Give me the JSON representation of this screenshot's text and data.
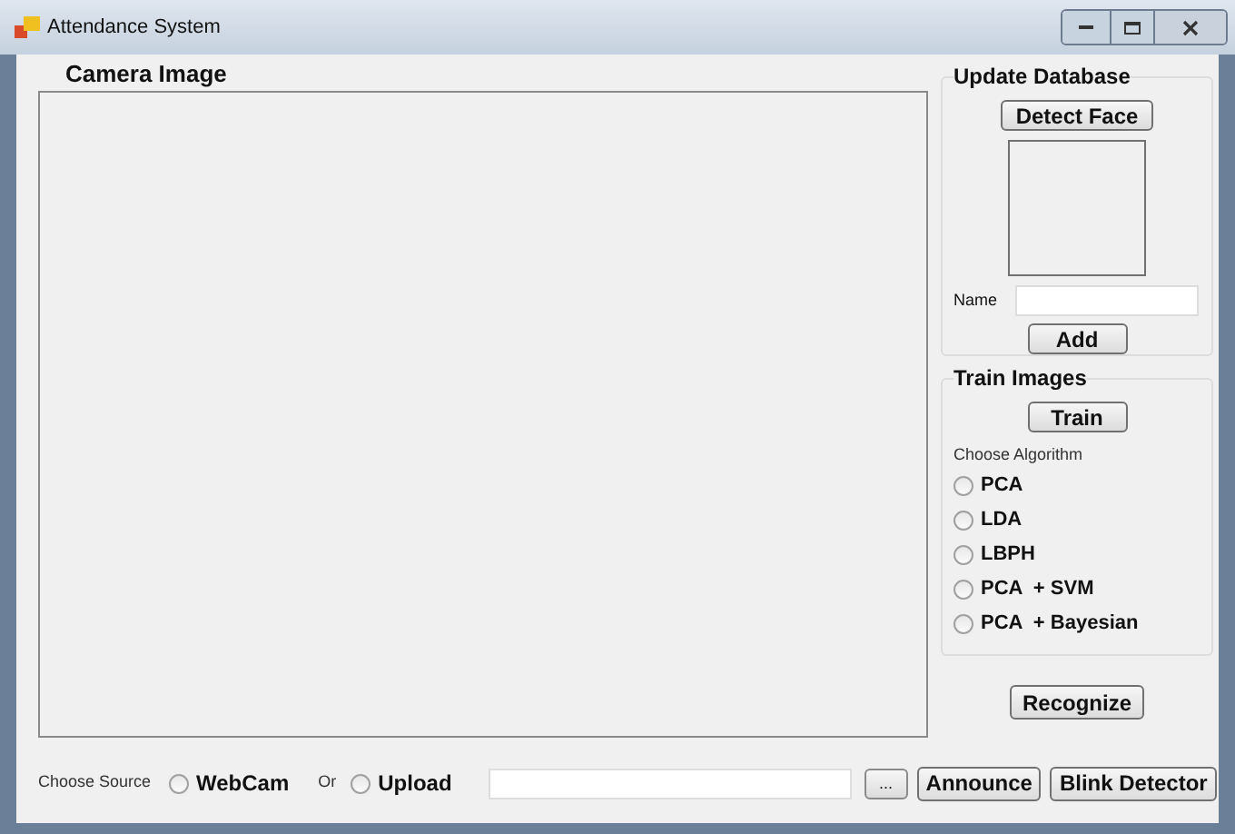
{
  "window": {
    "title": "Attendance System"
  },
  "camera": {
    "label": "Camera Image"
  },
  "update_database": {
    "title": "Update Database",
    "detect_button": "Detect Face",
    "name_label": "Name",
    "add_button": "Add"
  },
  "train_images": {
    "title": "Train Images",
    "train_button": "Train",
    "algorithm_label": "Choose Algorithm",
    "algorithms": [
      {
        "label": "PCA",
        "selected": false
      },
      {
        "label": "LDA",
        "selected": false
      },
      {
        "label": "LBPH",
        "selected": false
      },
      {
        "label": "PCA  + SVM",
        "selected": false
      },
      {
        "label": "PCA  + Bayesian",
        "selected": false
      }
    ]
  },
  "recognize_button": "Recognize",
  "source": {
    "label": "Choose Source",
    "or_label": "Or",
    "options": [
      {
        "label": "WebCam",
        "selected": false
      },
      {
        "label": "Upload",
        "selected": false
      }
    ],
    "browse_button": "..."
  },
  "buttons": [
    "Announce",
    "Blink Detector"
  ]
}
